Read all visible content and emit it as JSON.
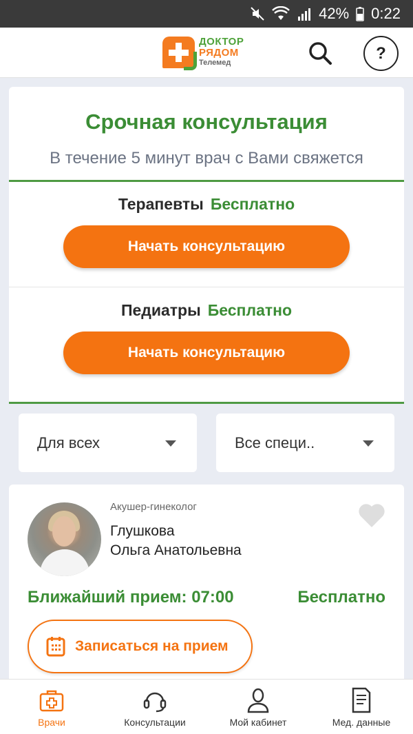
{
  "status_bar": {
    "battery": "42%",
    "time": "0:22",
    "icons": [
      "mute-icon",
      "wifi-icon",
      "signal-icon",
      "battery-icon"
    ]
  },
  "app_bar": {
    "logo": {
      "line1": "ДОКТОР",
      "line2": "РЯДОМ",
      "line3": "Телемед"
    },
    "help_label": "?"
  },
  "urgent": {
    "title": "Срочная консультация",
    "subtitle": "В течение 5 минут врач с Вами свяжется",
    "options": [
      {
        "specialty": "Терапевты",
        "price": "Бесплатно",
        "button": "Начать консультацию"
      },
      {
        "specialty": "Педиатры",
        "price": "Бесплатно",
        "button": "Начать консультацию"
      }
    ]
  },
  "filters": {
    "audience": "Для всех",
    "specialty": "Все специ.."
  },
  "doctor": {
    "specialty": "Акушер-гинеколог",
    "last_name": "Глушкова",
    "first_middle": "Ольга Анатольевна",
    "nearest": "Ближайший прием: 07:00",
    "price": "Бесплатно",
    "book_label": "Записаться на прием"
  },
  "bottom_nav": [
    {
      "label": "Врачи",
      "icon": "medkit-icon",
      "active": true
    },
    {
      "label": "Консультации",
      "icon": "headset-icon",
      "active": false
    },
    {
      "label": "Мой кабинет",
      "icon": "user-icon",
      "active": false
    },
    {
      "label": "Мед. данные",
      "icon": "document-icon",
      "active": false
    }
  ],
  "colors": {
    "accent_orange": "#f47311",
    "accent_green": "#3b8d35",
    "background": "#e9ecf3"
  }
}
